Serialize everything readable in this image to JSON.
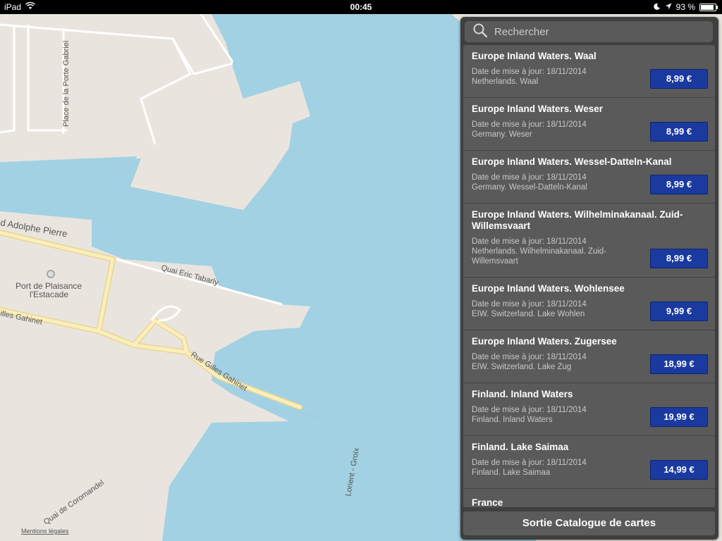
{
  "status_bar": {
    "carrier": "iPad",
    "time": "00:45",
    "battery_percent": "93 %"
  },
  "map": {
    "labels": {
      "place_porte_gabriel": "Place de la Porte Gabriel",
      "adolphe_pierre": "d Adolphe Pierre",
      "port_plaisance_1": "Port de Plaisance",
      "port_plaisance_2": "l'Estacade",
      "quai_eric_tabarly": "Quai Eric Tabarly",
      "gilles_gahinet_left": "illes Gahinet",
      "rue_gilles_gahinet": "Rue Gilles Gahinet",
      "lorient_groix": "Lorient - Groix",
      "quai_coromandel": "Quai de Coromandel",
      "legal": "Mentions légales"
    },
    "colors": {
      "water": "#a2d1e3",
      "land": "#e9e5de",
      "road": "#f4e4a6"
    }
  },
  "catalog": {
    "search_placeholder": "Rechercher",
    "items": [
      {
        "title": "Europe Inland Waters. Waal",
        "date": "Date de mise à jour: 18/11/2014",
        "region": "Netherlands. Waal",
        "price": "8,99 €"
      },
      {
        "title": "Europe Inland Waters. Weser",
        "date": "Date de mise à jour: 18/11/2014",
        "region": "Germany. Weser",
        "price": "8,99 €"
      },
      {
        "title": "Europe Inland Waters. Wessel-Datteln-Kanal",
        "date": "Date de mise à jour: 18/11/2014",
        "region": "Germany. Wessel-Datteln-Kanal",
        "price": "8,99 €"
      },
      {
        "title": "Europe Inland Waters. Wilhelminakanaal. Zuid-Willemsvaart",
        "date": "Date de mise à jour: 18/11/2014",
        "region": "Netherlands. Wilhelminakanaal. Zuid-Willemsvaart",
        "price": "8,99 €"
      },
      {
        "title": "Europe Inland Waters. Wohlensee",
        "date": "Date de mise à jour: 18/11/2014",
        "region": "EIW. Switzerland. Lake Wohlen",
        "price": "9,99 €"
      },
      {
        "title": "Europe Inland Waters. Zugersee",
        "date": "Date de mise à jour: 18/11/2014",
        "region": "EIW. Switzerland. Lake Zug",
        "price": "18,99 €"
      },
      {
        "title": "Finland. Inland Waters",
        "date": "Date de mise à jour: 18/11/2014",
        "region": "Finland. Inland Waters",
        "price": "19,99 €"
      },
      {
        "title": "Finland. Lake Saimaa",
        "date": "Date de mise à jour: 18/11/2014",
        "region": "Finland. Lake Saimaa",
        "price": "14,99 €"
      },
      {
        "title": "France"
      }
    ],
    "exit_label": "Sortie Catalogue de cartes"
  },
  "colors": {
    "panel_bg": "#3f3f3f",
    "list_bg": "#5a5a5a",
    "price_button": "#1a3aa0"
  }
}
